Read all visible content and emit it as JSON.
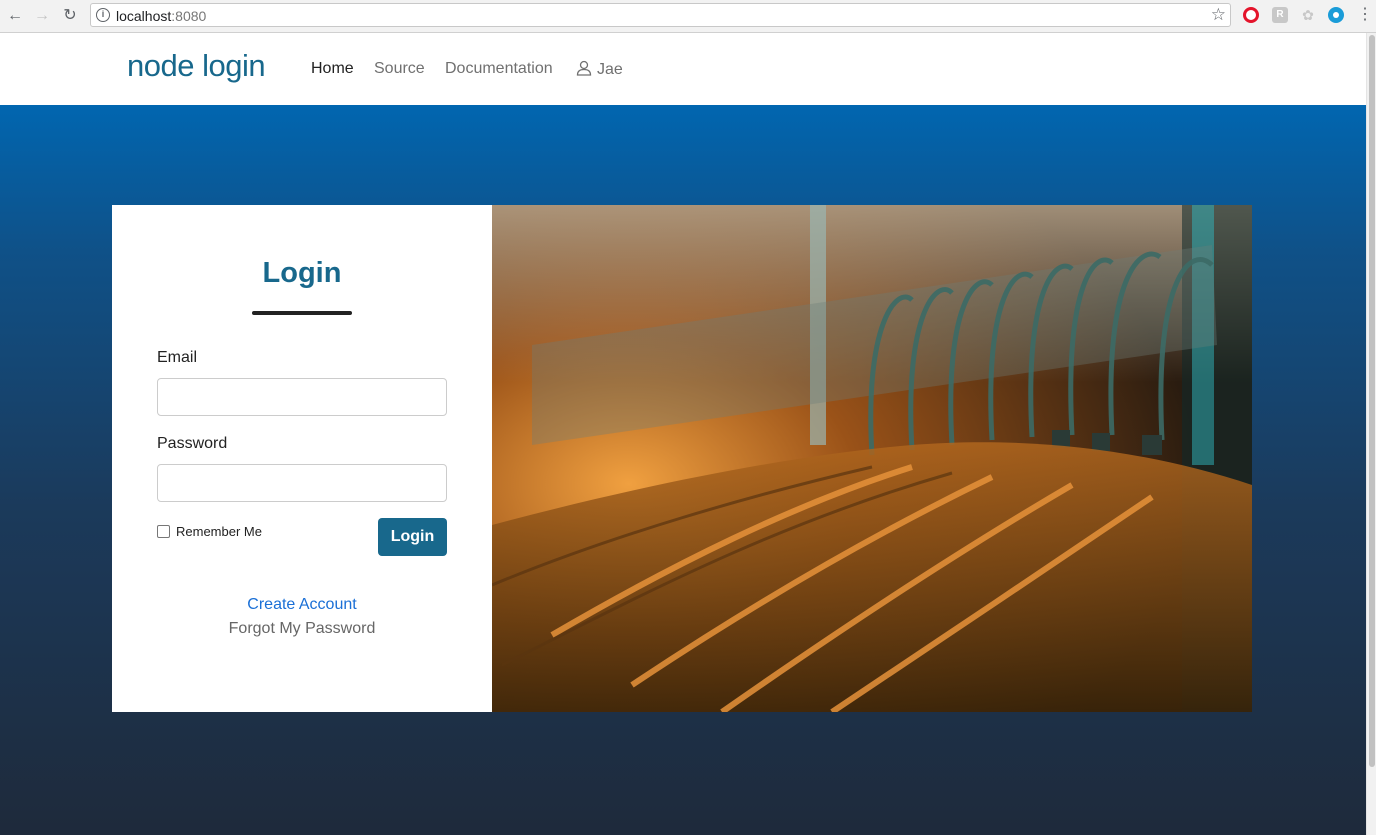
{
  "browser": {
    "url_host": "localhost",
    "url_port": ":8080"
  },
  "navbar": {
    "brand": "node login",
    "links": [
      {
        "label": "Home",
        "active": true
      },
      {
        "label": "Source",
        "active": false
      },
      {
        "label": "Documentation",
        "active": false
      }
    ],
    "user": "Jae"
  },
  "login": {
    "title": "Login",
    "email_label": "Email",
    "email_value": "",
    "password_label": "Password",
    "password_value": "",
    "remember_label": "Remember Me",
    "remember_checked": false,
    "submit_label": "Login",
    "create_account": "Create Account",
    "forgot_password": "Forgot My Password"
  },
  "colors": {
    "brand": "#18688c",
    "hero_top": "#0166b0",
    "hero_bottom": "#1e2a3b",
    "link": "#1a6fd6"
  }
}
